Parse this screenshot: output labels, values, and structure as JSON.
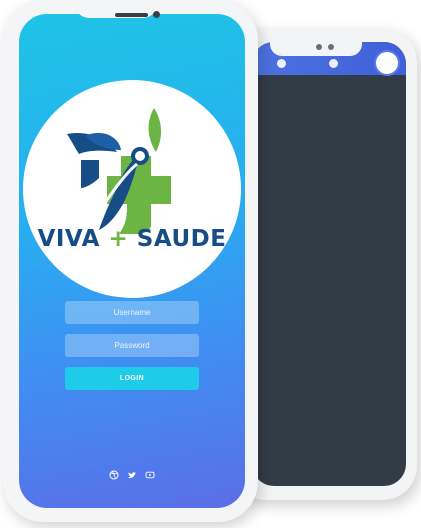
{
  "app": {
    "brand_left": "VIVA",
    "brand_plus": "+",
    "brand_right": "SAUDE"
  },
  "login": {
    "username_placeholder": "Username",
    "password_placeholder": "Password",
    "login_label": "LOGIN"
  },
  "social": [
    "dribbble-icon",
    "twitter-icon",
    "youtube-icon"
  ],
  "back_screen": {
    "tabs": [
      "clock-icon",
      "fire-icon"
    ]
  },
  "colors": {
    "gradient_top": "#1fc3e6",
    "gradient_bottom": "#5b6ee8",
    "brand_blue": "#164d86",
    "brand_green": "#6cb443",
    "login_button": "#1ecbe8",
    "back_screen_bg": "#323c47",
    "back_tabbar": "#4d73e0"
  }
}
